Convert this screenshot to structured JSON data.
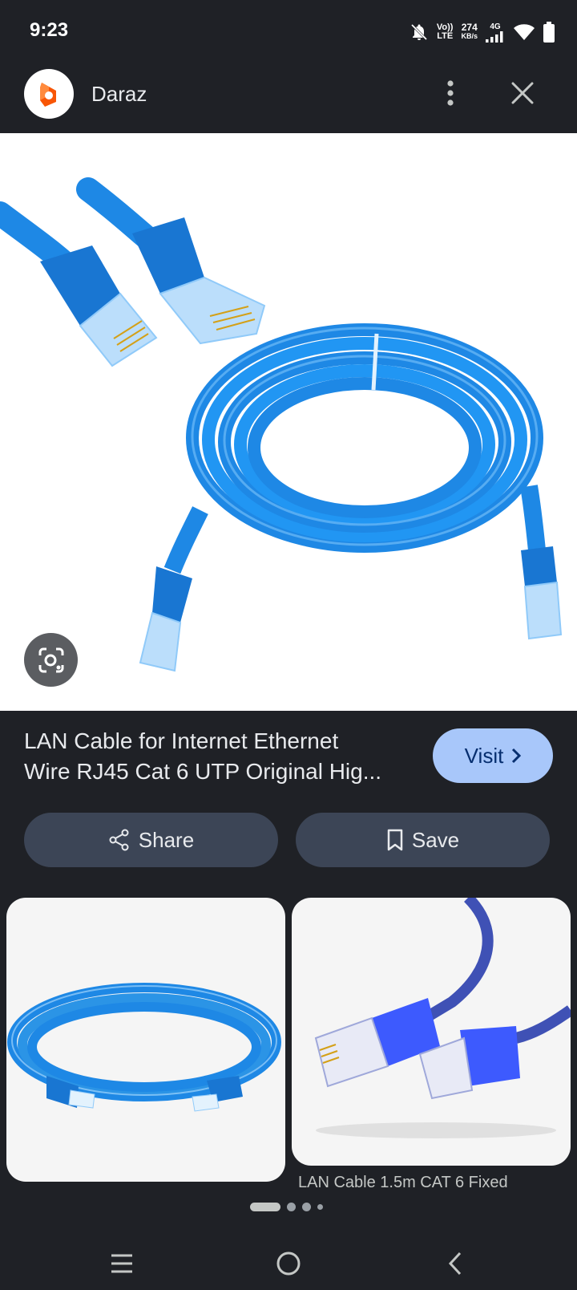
{
  "status_bar": {
    "time": "9:23",
    "volte_top": "Vo))",
    "volte_bottom": "LTE",
    "speed_value": "274",
    "speed_unit": "KB/s",
    "network": "4G",
    "icons": [
      "notifications-muted-icon",
      "signal-icon",
      "wifi-icon",
      "battery-icon"
    ]
  },
  "header": {
    "site_name": "Daraz",
    "logo_icon": "daraz-logo-icon",
    "brand_color": "#f85606"
  },
  "result": {
    "title_line1": "LAN Cable for Internet Ethernet",
    "title_line2": "Wire RJ45 Cat 6 UTP Original Hig...",
    "visit_label": "Visit",
    "share_label": "Share",
    "save_label": "Save"
  },
  "related": {
    "items": [
      {
        "caption": ""
      },
      {
        "caption": "LAN Cable 1.5m CAT 6 Fixed"
      }
    ]
  },
  "colors": {
    "background": "#1f2126",
    "visit_button": "#a8c7fa",
    "action_button": "#3c4556",
    "cable_blue": "#1e88e5"
  },
  "pager": {
    "count": 4,
    "active": 0
  }
}
